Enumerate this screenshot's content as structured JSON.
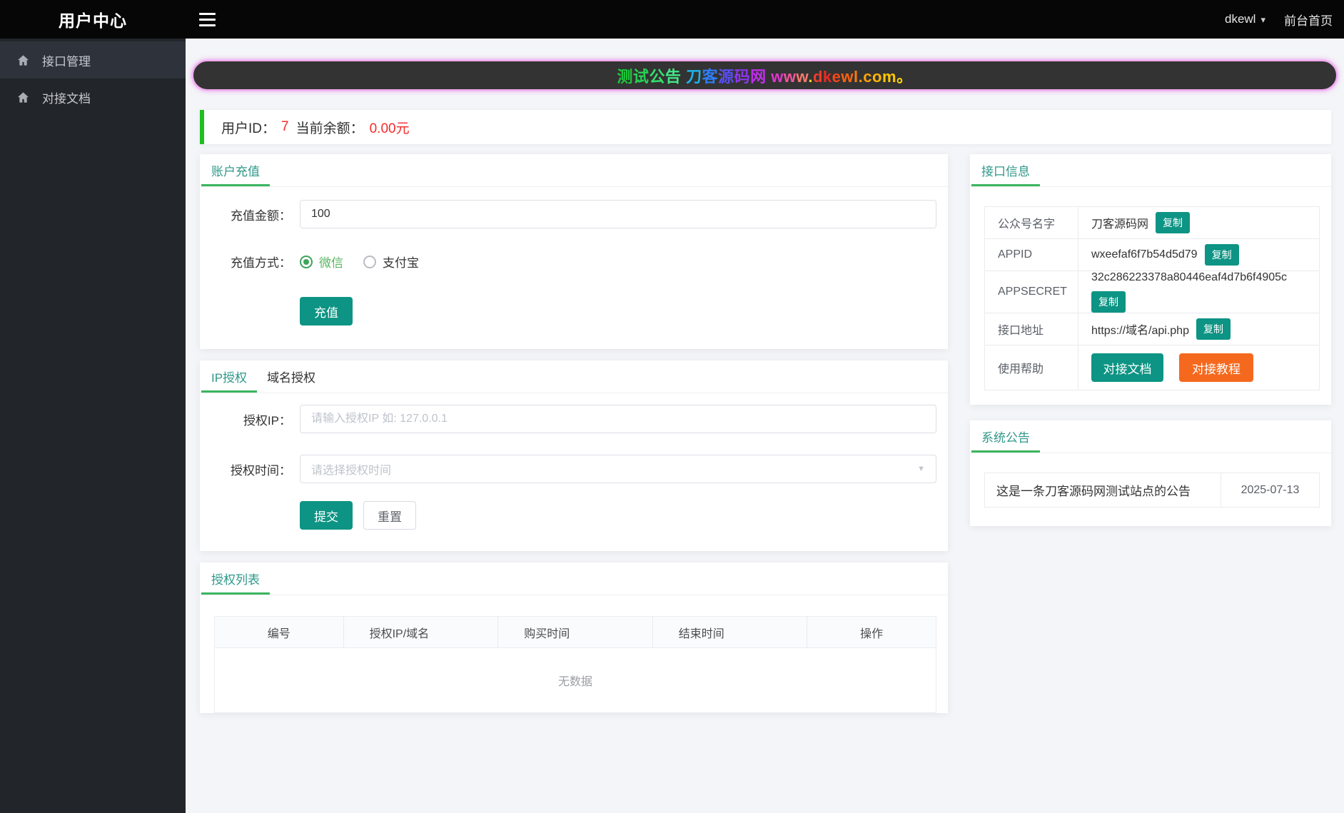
{
  "header": {
    "title": "用户中心",
    "username": "dkewl",
    "home_link": "前台首页"
  },
  "sidebar": {
    "items": [
      {
        "icon": "home-icon",
        "label": "接口管理",
        "active": true
      },
      {
        "icon": "home-icon",
        "label": "对接文档",
        "active": false
      }
    ]
  },
  "banner": {
    "text": "测试公告 刀客源码网 www.dkewl.com。",
    "parts": [
      {
        "text": "测",
        "color": "#1ec83c"
      },
      {
        "text": "试",
        "color": "#27d454"
      },
      {
        "text": "公",
        "color": "#35de6e"
      },
      {
        "text": "告",
        "color": "#43e787"
      },
      {
        "text": " ",
        "color": "#43e787"
      },
      {
        "text": "刀",
        "color": "#1db4e8"
      },
      {
        "text": "客",
        "color": "#2f7cf6"
      },
      {
        "text": "源",
        "color": "#5a4ef2"
      },
      {
        "text": "码",
        "color": "#8c35ee"
      },
      {
        "text": "网",
        "color": "#bf2eeb"
      },
      {
        "text": " ",
        "color": "#bf2eeb"
      },
      {
        "text": "w",
        "color": "#e135cf"
      },
      {
        "text": "w",
        "color": "#f2559e"
      },
      {
        "text": "w",
        "color": "#fb7a6e"
      },
      {
        "text": ".",
        "color": "#ffd21e"
      },
      {
        "text": "d",
        "color": "#f53b2a"
      },
      {
        "text": "k",
        "color": "#f0291f"
      },
      {
        "text": "e",
        "color": "#f54718"
      },
      {
        "text": "w",
        "color": "#f9640f"
      },
      {
        "text": "l",
        "color": "#fb7b0a"
      },
      {
        "text": ".",
        "color": "#fd9206"
      },
      {
        "text": "c",
        "color": "#fea403"
      },
      {
        "text": "o",
        "color": "#ffb602"
      },
      {
        "text": "m",
        "color": "#ffc801"
      },
      {
        "text": "。",
        "color": "#ffd800"
      }
    ]
  },
  "user_bar": {
    "id_label": "用户ID：",
    "id_value": "7",
    "balance_label": "当前余额：",
    "balance_value": "0.00元"
  },
  "recharge_card": {
    "title": "账户充值",
    "amount_label": "充值金额：",
    "amount_value": "100",
    "method_label": "充值方式：",
    "methods": [
      {
        "label": "微信",
        "checked": true
      },
      {
        "label": "支付宝",
        "checked": false
      }
    ],
    "submit_label": "充值"
  },
  "auth_card": {
    "tabs": [
      {
        "label": "IP授权",
        "active": true
      },
      {
        "label": "域名授权",
        "active": false
      }
    ],
    "ip_label": "授权IP：",
    "ip_placeholder": "请输入授权IP 如: 127.0.0.1",
    "time_label": "授权时间：",
    "time_placeholder": "请选择授权时间",
    "submit_label": "提交",
    "reset_label": "重置"
  },
  "auth_list_card": {
    "title": "授权列表",
    "columns": [
      "编号",
      "授权IP/域名",
      "购买时间",
      "结束时间",
      "操作"
    ],
    "empty_text": "无数据"
  },
  "api_card": {
    "title": "接口信息",
    "copy_label": "复制",
    "rows": [
      {
        "label": "公众号名字",
        "value": "刀客源码网"
      },
      {
        "label": "APPID",
        "value": "wxeefaf6f7b54d5d79"
      },
      {
        "label": "APPSECRET",
        "value": "32c286223378a80446eaf4d7b6f4905c"
      },
      {
        "label": "接口地址",
        "value": "https://域名/api.php"
      },
      {
        "label": "使用帮助"
      }
    ],
    "help_buttons": [
      {
        "label": "对接文档",
        "style": "teal"
      },
      {
        "label": "对接教程",
        "style": "orange"
      }
    ]
  },
  "notice_card": {
    "title": "系统公告",
    "rows": [
      {
        "text": "这是一条刀客源码网测试站点的公告",
        "date": "2025-07-13"
      }
    ]
  },
  "colors": {
    "accent_teal": "#0d9484",
    "tab_active_text": "#2f988a",
    "tab_underline_green": "#3bb560",
    "alert_red": "#f42a2a",
    "user_bar_green": "#1fbf1f",
    "orange_button": "#f5691e",
    "topbar_black": "#060606",
    "sidebar_dark": "#222529",
    "page_background": "#f4f5f9",
    "banner_glow_pink": "#f2abf0"
  }
}
